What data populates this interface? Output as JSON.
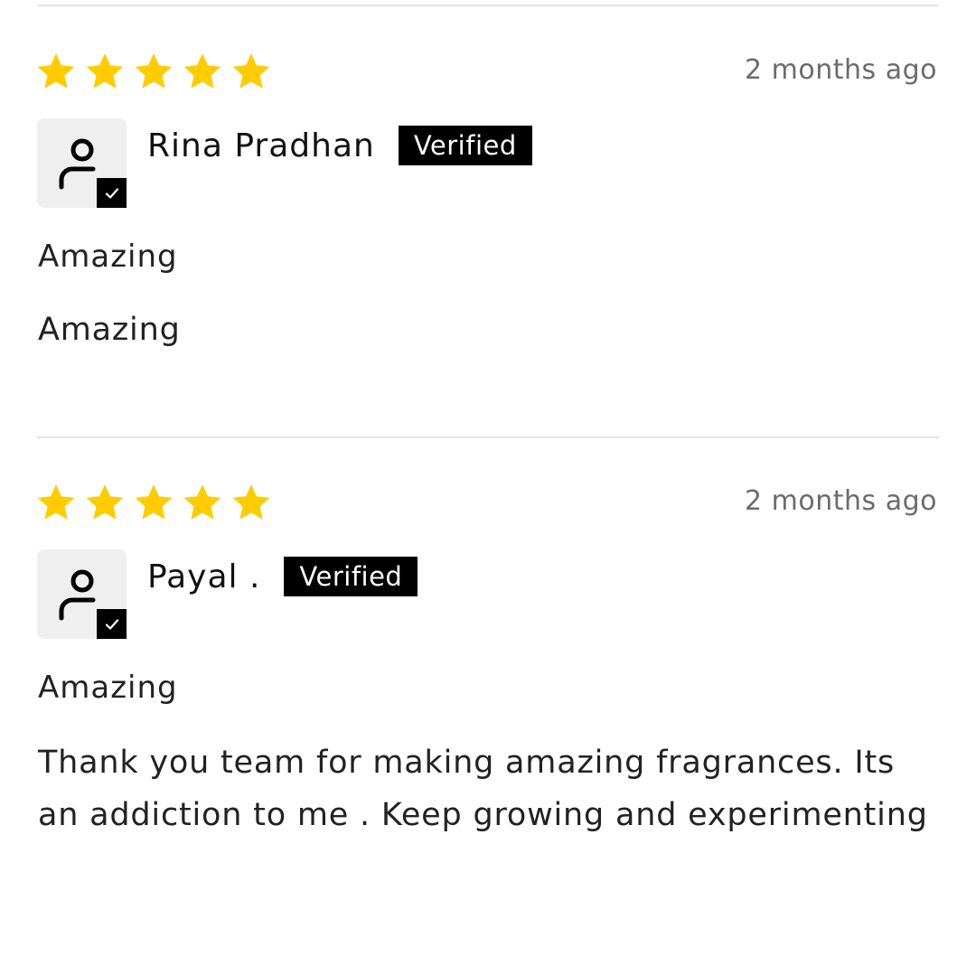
{
  "reviews": [
    {
      "rating": 5,
      "date": "2 months ago",
      "reviewer": "Rina Pradhan",
      "badge": "Verified",
      "title": "Amazing",
      "body": "Amazing"
    },
    {
      "rating": 5,
      "date": "2 months ago",
      "reviewer": "Payal .",
      "badge": "Verified",
      "title": "Amazing",
      "body": "Thank you team for making amazing fragrances. Its an addiction to me . Keep growing and experimenting"
    }
  ],
  "icons": {
    "star": "star-icon",
    "avatar": "user-icon",
    "verified_check": "checkmark-icon"
  },
  "colors": {
    "star": "#FFCC00",
    "badge_bg": "#000000",
    "badge_text": "#FFFFFF",
    "date_text": "#6B6B6B",
    "divider": "#E3E3E3",
    "avatar_bg": "#EFEFEF"
  }
}
